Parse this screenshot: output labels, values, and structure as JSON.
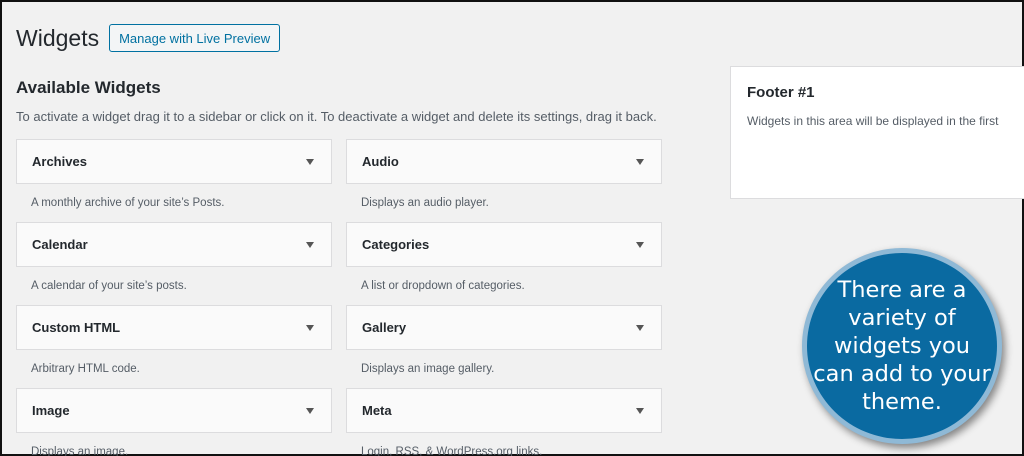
{
  "header": {
    "title": "Widgets",
    "preview_button": "Manage with Live Preview"
  },
  "available": {
    "title": "Available Widgets",
    "description": "To activate a widget drag it to a sidebar or click on it. To deactivate a widget and delete its settings, drag it back."
  },
  "widgets": [
    {
      "name": "Archives",
      "description": "A monthly archive of your site’s Posts."
    },
    {
      "name": "Audio",
      "description": "Displays an audio player."
    },
    {
      "name": "Calendar",
      "description": "A calendar of your site’s posts."
    },
    {
      "name": "Categories",
      "description": "A list or dropdown of categories."
    },
    {
      "name": "Custom HTML",
      "description": "Arbitrary HTML code."
    },
    {
      "name": "Gallery",
      "description": "Displays an image gallery."
    },
    {
      "name": "Image",
      "description": "Displays an image."
    },
    {
      "name": "Meta",
      "description": "Login, RSS, & WordPress.org links."
    }
  ],
  "sidebar": {
    "title": "Footer #1",
    "description": "Widgets in this area will be displayed in the first"
  },
  "callout": {
    "text": "There are a variety of widgets you can add to your theme."
  },
  "icons": {
    "widget_toggle": "chevron-down-icon"
  },
  "colors": {
    "accent": "#0071a1",
    "callout_bg": "#0a6aa1"
  }
}
